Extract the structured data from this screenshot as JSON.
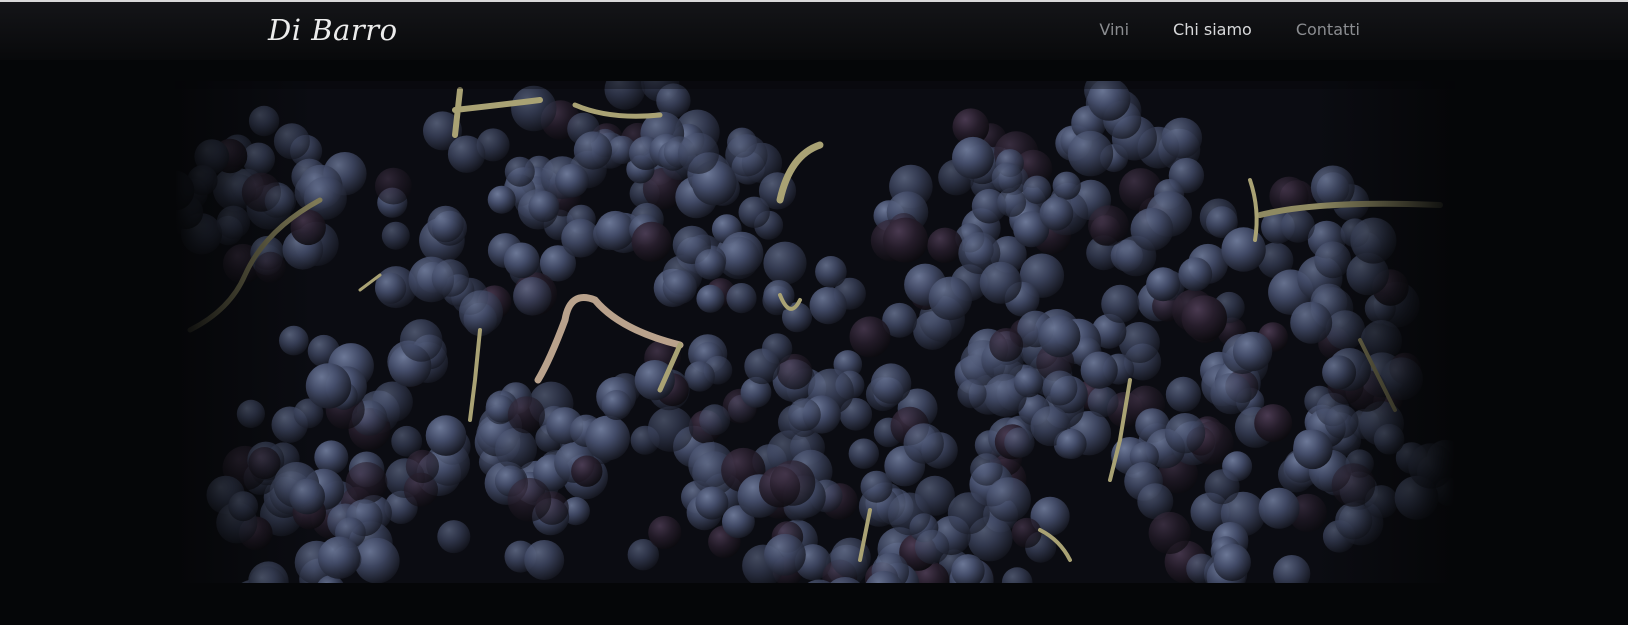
{
  "header": {
    "logo_text": "Di Barro"
  },
  "nav": {
    "items": [
      {
        "label": "Vini",
        "active": false
      },
      {
        "label": "Chi siamo",
        "active": true
      },
      {
        "label": "Contatti",
        "active": false
      }
    ]
  },
  "hero": {
    "image": "grapes-photo"
  },
  "colors": {
    "background": "#050608",
    "grape": "#3f4762",
    "stem": "#a79f70",
    "nav_inactive": "#8b8d91",
    "nav_active": "#d8d9db"
  }
}
